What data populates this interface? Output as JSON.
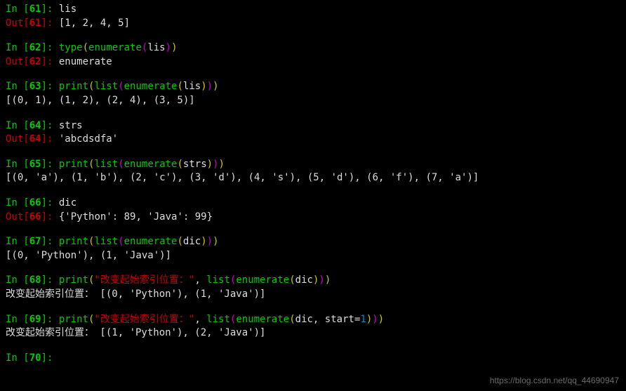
{
  "cells": {
    "c61": {
      "in_pre": "In [",
      "in_num": "61",
      "in_post": "]: ",
      "code_var": "lis",
      "out_pre": "Out[",
      "out_num": "61",
      "out_post": "]: ",
      "output": "[1, 2, 4, 5]"
    },
    "c62": {
      "in_pre": "In [",
      "in_num": "62",
      "in_post": "]: ",
      "func1": "type",
      "p1o": "(",
      "func2": "enumerate",
      "p2o": "(",
      "arg": "lis",
      "p2c": ")",
      "p1c": ")",
      "out_pre": "Out[",
      "out_num": "62",
      "out_post": "]: ",
      "output": "enumerate"
    },
    "c63": {
      "in_pre": "In [",
      "in_num": "63",
      "in_post": "]: ",
      "func1": "print",
      "p1o": "(",
      "func2": "list",
      "p2o": "(",
      "func3": "enumerate",
      "p3o": "(",
      "arg": "lis",
      "p3c": ")",
      "p2c": ")",
      "p1c": ")",
      "output": "[(0, 1), (1, 2), (2, 4), (3, 5)]"
    },
    "c64": {
      "in_pre": "In [",
      "in_num": "64",
      "in_post": "]: ",
      "code_var": "strs",
      "out_pre": "Out[",
      "out_num": "64",
      "out_post": "]: ",
      "output": "'abcdsdfa'"
    },
    "c65": {
      "in_pre": "In [",
      "in_num": "65",
      "in_post": "]: ",
      "func1": "print",
      "p1o": "(",
      "func2": "list",
      "p2o": "(",
      "func3": "enumerate",
      "p3o": "(",
      "arg": "strs",
      "p3c": ")",
      "p2c": ")",
      "p1c": ")",
      "output": "[(0, 'a'), (1, 'b'), (2, 'c'), (3, 'd'), (4, 's'), (5, 'd'), (6, 'f'), (7, 'a')]"
    },
    "c66": {
      "in_pre": "In [",
      "in_num": "66",
      "in_post": "]: ",
      "code_var": "dic",
      "out_pre": "Out[",
      "out_num": "66",
      "out_post": "]: ",
      "output": "{'Python': 89, 'Java': 99}"
    },
    "c67": {
      "in_pre": "In [",
      "in_num": "67",
      "in_post": "]: ",
      "func1": "print",
      "p1o": "(",
      "func2": "list",
      "p2o": "(",
      "func3": "enumerate",
      "p3o": "(",
      "arg": "dic",
      "p3c": ")",
      "p2c": ")",
      "p1c": ")",
      "output": "[(0, 'Python'), (1, 'Java')]"
    },
    "c68": {
      "in_pre": "In [",
      "in_num": "68",
      "in_post": "]: ",
      "func1": "print",
      "p1o": "(",
      "str": "\"改变起始索引位置：\"",
      "comma": ", ",
      "func2": "list",
      "p2o": "(",
      "func3": "enumerate",
      "p3o": "(",
      "arg": "dic",
      "p3c": ")",
      "p2c": ")",
      "p1c": ")",
      "output": "改变起始索引位置： [(0, 'Python'), (1, 'Java')]"
    },
    "c69": {
      "in_pre": "In [",
      "in_num": "69",
      "in_post": "]: ",
      "func1": "print",
      "p1o": "(",
      "str": "\"改变起始索引位置：\"",
      "comma": ", ",
      "func2": "list",
      "p2o": "(",
      "func3": "enumerate",
      "p3o": "(",
      "arg": "dic, start",
      "eq": "=",
      "argnum": "1",
      "p3c": ")",
      "p2c": ")",
      "p1c": ")",
      "output": "改变起始索引位置： [(1, 'Python'), (2, 'Java')]"
    },
    "c70": {
      "in_pre": "In [",
      "in_num": "70",
      "in_post": "]:"
    }
  },
  "watermark": "https://blog.csdn.net/qq_44690947"
}
